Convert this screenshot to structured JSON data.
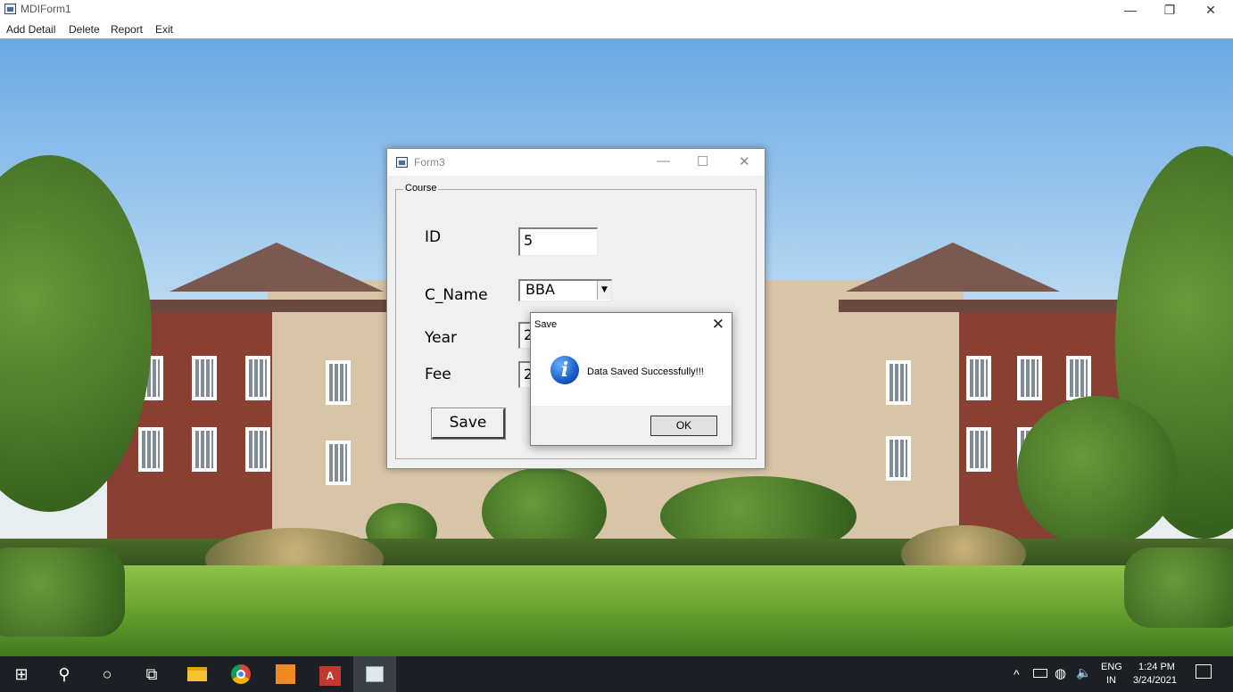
{
  "mdi": {
    "title": "MDIForm1",
    "controls": {
      "minimize": "—",
      "restore": "❐",
      "close": "✕"
    }
  },
  "menu": {
    "items": [
      "Add Detail",
      "Delete",
      "Report",
      "Exit"
    ]
  },
  "form3": {
    "title": "Form3",
    "controls": {
      "minimize": "—",
      "maximize": "☐",
      "close": "✕"
    },
    "group_label": "Course",
    "fields": {
      "id_label": "ID",
      "id_value": "5",
      "cname_label": "C_Name",
      "cname_value": "BBA",
      "year_label": "Year",
      "year_value": "2",
      "fee_label": "Fee",
      "fee_value": "2"
    },
    "save_label": "Save"
  },
  "msgbox": {
    "title": "Save",
    "close": "✕",
    "icon": "info-icon",
    "icon_glyph": "i",
    "message": "Data Saved Successfully!!!",
    "ok_label": "OK"
  },
  "taskbar": {
    "start": "⊞",
    "search": "⚲",
    "cortana": "○",
    "taskview": "⧉",
    "tray": {
      "chevron": "^",
      "lang_top": "ENG",
      "lang_bottom": "IN",
      "time": "1:24 PM",
      "date": "3/24/2021",
      "notification": "🗨"
    }
  },
  "colors": {
    "taskbar": "#1c1f24",
    "info_icon": "#1a5cc8"
  }
}
